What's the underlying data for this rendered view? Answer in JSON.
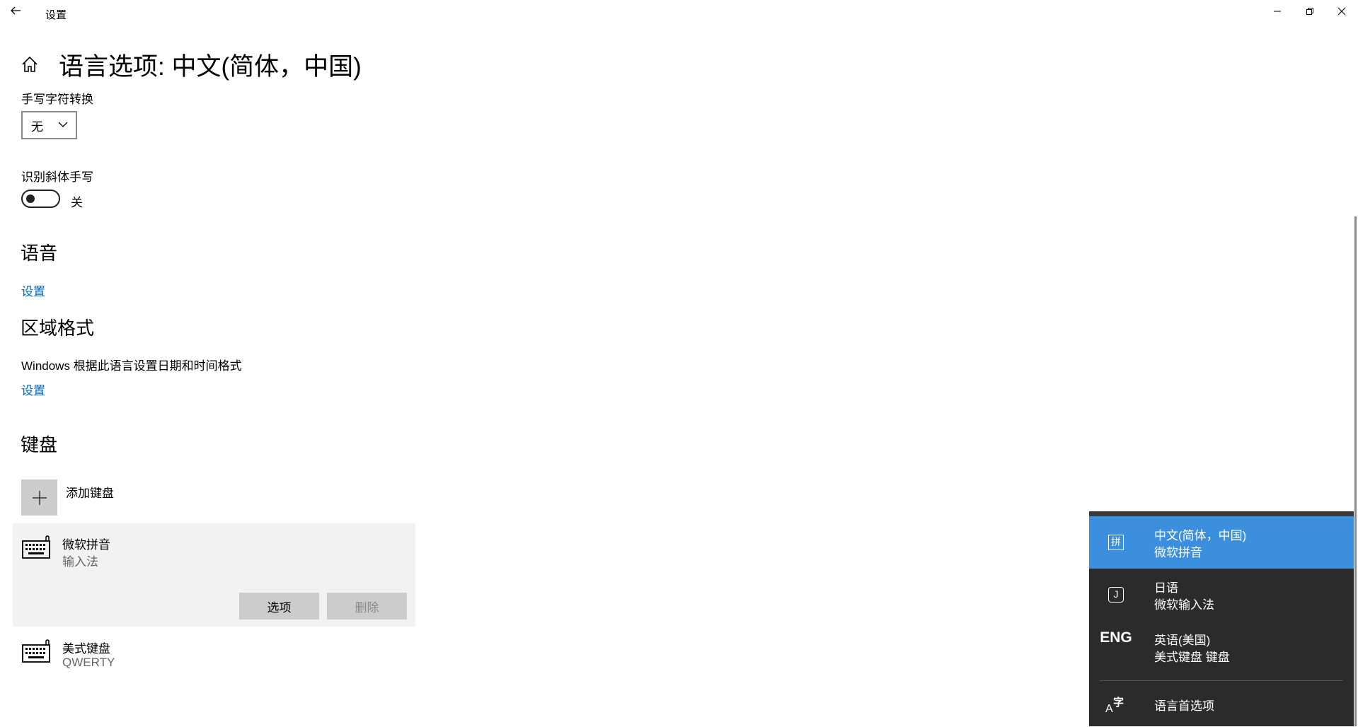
{
  "window": {
    "title": "设置",
    "back_icon": "back-arrow-icon",
    "minimize_icon": "minimize-icon",
    "restore_icon": "restore-icon",
    "close_icon": "close-icon"
  },
  "header": {
    "home_icon": "home-icon",
    "title": "语言选项: 中文(简体，中国)"
  },
  "handwriting": {
    "label": "手写字符转换",
    "dropdown_value": "无",
    "slant_label": "识别斜体手写",
    "slant_toggle_state": "关",
    "slant_toggle_on": false
  },
  "speech": {
    "heading": "语音",
    "settings_link": "设置"
  },
  "region": {
    "heading": "区域格式",
    "description": "Windows 根据此语言设置日期和时间格式",
    "settings_link": "设置"
  },
  "keyboard": {
    "heading": "键盘",
    "add_label": "添加键盘",
    "items": [
      {
        "name": "微软拼音",
        "sub": "输入法",
        "icon": "keyboard-icon",
        "selected": true
      },
      {
        "name": "美式键盘",
        "sub": "QWERTY",
        "icon": "keyboard-icon",
        "selected": false
      }
    ],
    "options_label": "选项",
    "remove_label": "删除"
  },
  "flyout": {
    "items": [
      {
        "icon_text": "拼",
        "line1": "中文(简体，中国)",
        "line2": "微软拼音",
        "active": true
      },
      {
        "icon_text": "J",
        "line1": "日语",
        "line2": "微软输入法",
        "active": false
      },
      {
        "icon_text": "ENG",
        "line1": "英语(美国)",
        "line2": "美式键盘 键盘",
        "active": false
      }
    ],
    "preferences_icon_text": "字",
    "preferences_icon_letter": "A",
    "preferences_label": "语言首选项"
  },
  "colors": {
    "accent_link": "#0067c0",
    "flyout_bg": "#2b2b2b",
    "flyout_active": "#3b8fdc"
  }
}
